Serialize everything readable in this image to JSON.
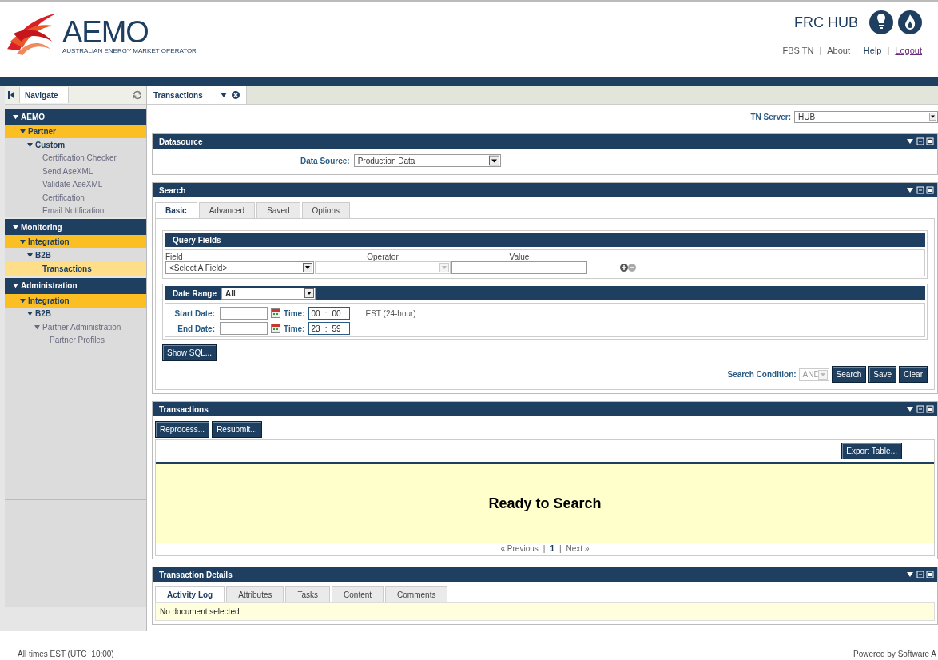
{
  "header": {
    "logo": {
      "name": "AEMO",
      "tagline": "AUSTRALIAN ENERGY MARKET OPERATOR"
    },
    "product": "FRC HUB",
    "links": [
      {
        "label": "FBS TN"
      },
      {
        "label": "About",
        "separator_before": "|"
      },
      {
        "label": "Help",
        "separator_before": "|"
      },
      {
        "label": "Logout",
        "separator_before": "|"
      }
    ]
  },
  "nav": {
    "title": "Navigate",
    "tree": [
      {
        "label": "AEMO",
        "expanded": true,
        "selected": false,
        "children": [
          {
            "label": "Partner",
            "expanded": true,
            "selected": false,
            "children": [
              {
                "label": "Custom",
                "expanded": true,
                "selected": false,
                "children": [
                  {
                    "label": "Certification Checker",
                    "selected": false
                  },
                  {
                    "label": "Send AseXML",
                    "selected": false
                  },
                  {
                    "label": "Validate AseXML",
                    "selected": false
                  },
                  {
                    "label": "Certification",
                    "selected": false
                  },
                  {
                    "label": "Email Notification",
                    "selected": false
                  }
                ]
              }
            ]
          }
        ]
      },
      {
        "label": "Monitoring",
        "expanded": true,
        "selected": false,
        "children": [
          {
            "label": "Integration",
            "expanded": true,
            "selected": false,
            "children": [
              {
                "label": "B2B",
                "expanded": true,
                "selected": false,
                "children": [
                  {
                    "label": "Transactions",
                    "selected": true
                  }
                ]
              }
            ]
          }
        ]
      },
      {
        "label": "Administration",
        "expanded": true,
        "selected": false,
        "children": [
          {
            "label": "Integration",
            "expanded": true,
            "selected": false,
            "children": [
              {
                "label": "B2B",
                "expanded": true,
                "selected": false,
                "children": [
                  {
                    "label": "Partner Administration",
                    "expanded": true,
                    "selected": false,
                    "children": [
                      {
                        "label": "Partner Profiles",
                        "selected": false
                      }
                    ]
                  }
                ]
              }
            ]
          }
        ]
      }
    ]
  },
  "workspace_tab": {
    "label": "Transactions"
  },
  "tn_server": {
    "label": "TN Server:",
    "value": "HUB"
  },
  "datasource": {
    "title": "Datasource",
    "label": "Data Source:",
    "value": "Production Data"
  },
  "search": {
    "title": "Search",
    "tabs": [
      {
        "label": "Basic",
        "selected": true
      },
      {
        "label": "Advanced",
        "selected": false
      },
      {
        "label": "Saved",
        "selected": false
      },
      {
        "label": "Options",
        "selected": false
      }
    ],
    "query_fields": {
      "title": "Query Fields",
      "field_label": "Field",
      "operator_label": "Operator",
      "value_label": "Value",
      "field_value": "<Select A Field>",
      "operator_disabled": true
    },
    "date_range": {
      "label": "Date Range",
      "value": "All",
      "rows": [
        {
          "label": "Start Date:",
          "time_label": "Time:",
          "hours": "00",
          "separator": ":",
          "minutes": "00",
          "note": "EST (24-hour)"
        },
        {
          "label": "End Date:",
          "time_label": "Time:",
          "hours": "23",
          "separator": ":",
          "minutes": "59"
        }
      ]
    },
    "show_sql": "Show SQL...",
    "condition_label": "Search Condition:",
    "condition_value": "AND",
    "condition_disabled": true,
    "buttons": [
      "Search",
      "Save",
      "Clear"
    ]
  },
  "transactions": {
    "title": "Transactions",
    "actions": [
      "Reprocess...",
      "Resubmit..."
    ],
    "export": "Export Table...",
    "message": "Ready to Search",
    "pager": [
      {
        "kind": "link",
        "label": "« Previous"
      },
      {
        "kind": "separator",
        "label": "|"
      },
      {
        "kind": "current",
        "label": "1"
      },
      {
        "kind": "separator",
        "label": "|"
      },
      {
        "kind": "link",
        "label": "Next »"
      }
    ]
  },
  "details": {
    "title": "Transaction Details",
    "tabs": [
      {
        "label": "Activity Log",
        "selected": true
      },
      {
        "label": "Attributes",
        "selected": false
      },
      {
        "label": "Tasks",
        "selected": false
      },
      {
        "label": "Content",
        "selected": false
      },
      {
        "label": "Comments",
        "selected": false
      }
    ],
    "message": "No document selected"
  },
  "footer": {
    "timezone": "All times EST (UTC+10:00)",
    "powered_by": "Powered by Software A"
  }
}
